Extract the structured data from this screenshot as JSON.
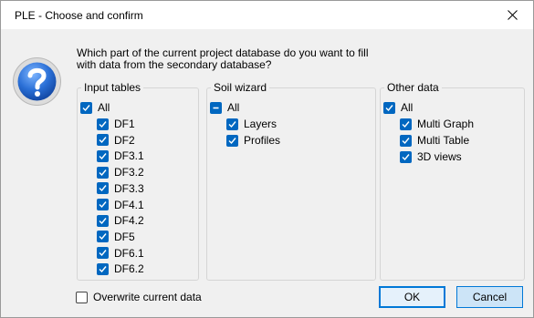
{
  "window": {
    "title": "PLE - Choose and confirm"
  },
  "question": "Which part of the current project database do you want to fill with data from the secondary database?",
  "groups": {
    "input_tables": {
      "title": "Input tables",
      "all_label": "All",
      "items": [
        "DF1",
        "DF2",
        "DF3.1",
        "DF3.2",
        "DF3.3",
        "DF4.1",
        "DF4.2",
        "DF5",
        "DF6.1",
        "DF6.2"
      ]
    },
    "soil_wizard": {
      "title": "Soil wizard",
      "all_label": "All",
      "items": [
        "Layers",
        "Profiles"
      ]
    },
    "other_data": {
      "title": "Other data",
      "all_label": "All",
      "items": [
        "Multi Graph",
        "Multi Table",
        "3D views"
      ]
    }
  },
  "overwrite_label": "Overwrite current data",
  "buttons": {
    "ok": "OK",
    "cancel": "Cancel"
  },
  "colors": {
    "accent": "#0067c0"
  }
}
